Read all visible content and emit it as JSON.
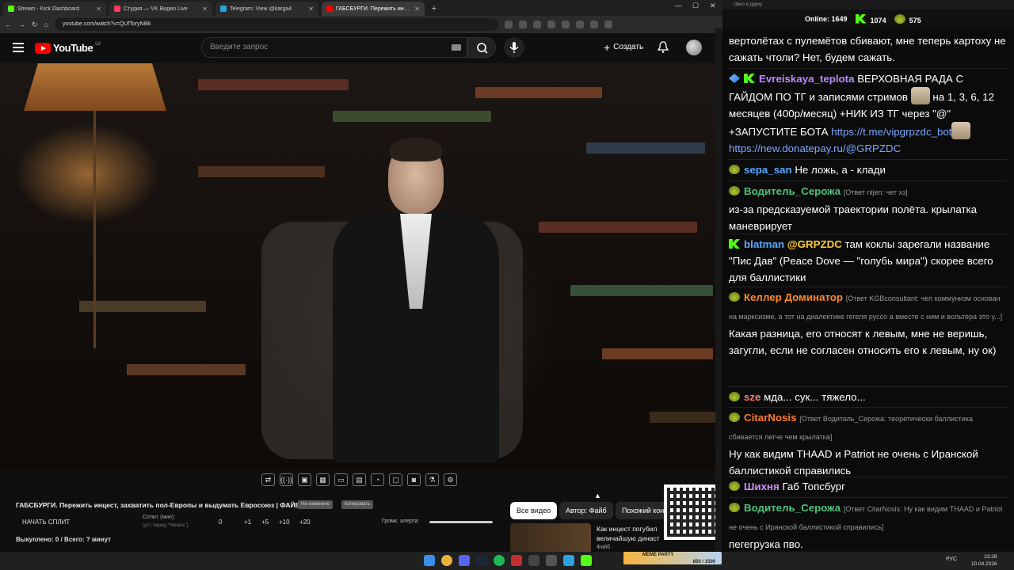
{
  "browser": {
    "tabs": [
      {
        "title": "Stream - Kick Dashboard",
        "color": "#53fc18"
      },
      {
        "title": "Студия — VK Видео Live",
        "color": "#ff3b5c"
      },
      {
        "title": "Telegram: View @karga4",
        "color": "#2aa3e0"
      },
      {
        "title": "ГАБСБУРГИ. Пережить инцест",
        "color": "#ff0000"
      }
    ],
    "url": "youtube.com/watch?v=QUfToryN8ik"
  },
  "youtube": {
    "logo": "YouTube",
    "region": "LV",
    "search_placeholder": "Введите запрос",
    "create_label": "Создать"
  },
  "video": {
    "title": "ГАБСБУРГИ. Пережить инцест, захватить пол-Европы и выдумать Евросоюз | ФАЙБ",
    "chip1": "Не изменено",
    "chip2": "Копировать",
    "toolbar_icons": [
      "loop-icon",
      "broadcast-icon",
      "pip-icon",
      "film-icon",
      "screen-icon",
      "clip-icon",
      "speed-icon",
      "frame-icon",
      "camera-icon",
      "filter-icon",
      "settings-icon"
    ]
  },
  "split": {
    "start_label": "НАЧАТЬ СПЛИТ",
    "label": "Сплит (мин):",
    "sub": "(уст. перед \"Начать\")",
    "value": "0",
    "steps": [
      "+1",
      "+5",
      "+10",
      "+20"
    ],
    "alert_label": "Громк. алерта:",
    "bought": "Выкуплено: 0 / Всего: ? минут"
  },
  "reco": {
    "tabs": [
      "Все видео",
      "Автор: Файб",
      "Похожий кон"
    ],
    "title": "Как инцест погубил величайшую династ",
    "author": "Файб"
  },
  "chat": {
    "window_title": "Окно в дурку",
    "online_label": "Online:",
    "online": "1649",
    "kick_count": "1074",
    "green_count": "575",
    "messages": [
      {
        "top_text": "вертолётах с пулемётов сбивают, мне теперь картоху не сажать чтоли? Нет, будем сажать."
      },
      {
        "name": "Evreiskaya_teplota",
        "color": "#b48cff",
        "text1": "ВЕРХОВНАЯ РАДА С ГАЙДОМ ПО ТГ и записями стримов",
        "text2": "на 1, 3, 6, 12 месяцев (400р/месяц) +НИК ИЗ ТГ через \"@\" +ЗАПУСТИТЕ БОТА",
        "link1": "https://t.me/vipgrpzdc_bot",
        "link2": "https://new.donatepay.ru/@GRPZDC"
      },
      {
        "name": "sepa_san",
        "color": "#5ca7ff",
        "text": "Не ложь, а - клади"
      },
      {
        "name": "Водитель_Серожа",
        "color": "#4ec27c",
        "reply": "[Ответ nijen: чет хз]",
        "text": "из-за предсказуемой траектории полёта. крылатка маневрирует"
      },
      {
        "name": "blatman",
        "color": "#5ca7ff",
        "mention": "@GRPZDC",
        "text": "там коклы зарегали название \"Пис Дав\" (Peace Dove — \"голубь мира\") скорее всего для баллистики"
      },
      {
        "name": "Келлер Доминатор",
        "color": "#ff8a2a",
        "reply": "[Ответ KGBconsultant: чел коммунизм основан на марксизме, а тот на диалектике гегеля руссо а вместе с ним и вольтера это у...]",
        "text": "Какая разница, его относят к левым, мне не веришь, загугли, если не согласен относить его к левым, ну ок)"
      },
      {
        "name": "sze",
        "color": "#ff7a7a",
        "text": "мда... сук... тяжело..."
      },
      {
        "name": "CitarNosis",
        "color": "#ff7a2a",
        "reply": "[Ответ Водитель_Серожа: теоретически баллистика сбивается легче чем крылатка]",
        "text": "Ну как видим THAAD и Patriot не очень с Иранской баллистикой справились"
      },
      {
        "name": "Шихня",
        "color": "#d68cff",
        "text": "Габ Топсбург"
      },
      {
        "name": "Водитель_Серожа",
        "color": "#4ec27c",
        "reply": "[Ответ CitarNosis: Ну как видим THAAD и Patriot не очень с Иранской баллистикой справились]",
        "text": "пегегрузка пво."
      }
    ]
  },
  "taskbar": {
    "meme_title": "MEME PARTY",
    "meme_progress": "850 / 1500",
    "lang": "РУС",
    "time": "23:28",
    "date": "10.04.2026"
  }
}
